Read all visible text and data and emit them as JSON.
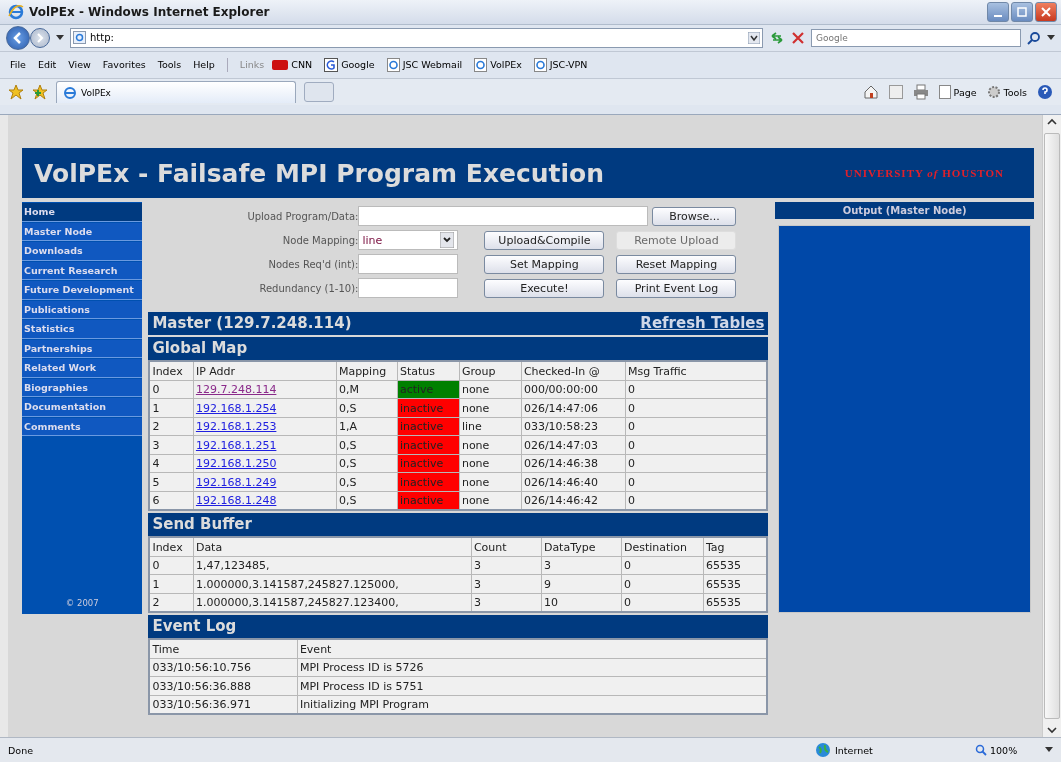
{
  "window": {
    "title": "VolPEx - Windows Internet Explorer"
  },
  "address_bar": {
    "value": "http:"
  },
  "search": {
    "placeholder": "Google"
  },
  "menu": [
    "File",
    "Edit",
    "View",
    "Favorites",
    "Tools",
    "Help"
  ],
  "links": {
    "label": "Links",
    "items": [
      {
        "label": "CNN",
        "kind": "cnn"
      },
      {
        "label": "Google",
        "kind": "google"
      },
      {
        "label": "JSC Webmail",
        "kind": "ie"
      },
      {
        "label": "VolPEx",
        "kind": "ie"
      },
      {
        "label": "JSC-VPN",
        "kind": "ie"
      }
    ]
  },
  "tabs": [
    {
      "label": "VolPEx",
      "selected": true
    }
  ],
  "command_bar": [
    {
      "label": "Page",
      "kind": "page"
    },
    {
      "label": "Tools",
      "kind": "tools"
    }
  ],
  "page": {
    "title": "VolPEx - Failsafe MPI Program Execution",
    "logo": "UNIVERSITY *of* HOUSTON"
  },
  "nav": [
    {
      "label": "Home",
      "selected": true
    },
    {
      "label": "Master Node",
      "selected": false
    },
    {
      "label": "Downloads",
      "selected": false
    },
    {
      "label": "Current Research",
      "selected": false
    },
    {
      "label": "Future Development",
      "selected": false
    },
    {
      "label": "Publications",
      "selected": false
    },
    {
      "label": "Statistics",
      "selected": false
    },
    {
      "label": "Partnerships",
      "selected": false
    },
    {
      "label": "Related Work",
      "selected": false
    },
    {
      "label": "Biographies",
      "selected": false
    },
    {
      "label": "Documentation",
      "selected": false
    },
    {
      "label": "Comments",
      "selected": false
    }
  ],
  "copyright": "© 2007",
  "form": {
    "fields": [
      {
        "label": "Upload Program/Data:",
        "kind": "file"
      },
      {
        "label": "Node Mapping:",
        "kind": "select",
        "value": "line"
      },
      {
        "label": "Nodes Req'd (int):",
        "kind": "text"
      },
      {
        "label": "Redundancy (1-10):",
        "kind": "text"
      }
    ],
    "browse": "Browse...",
    "buttons": [
      {
        "label": "Upload&Compile",
        "disabled": false
      },
      {
        "label": "Remote Upload",
        "disabled": true
      },
      {
        "label": "Set Mapping",
        "disabled": false
      },
      {
        "label": "Reset Mapping",
        "disabled": false
      },
      {
        "label": "Execute!",
        "disabled": false
      },
      {
        "label": "Print Event Log",
        "disabled": false
      }
    ]
  },
  "master": {
    "title": "Master (129.7.248.114)",
    "refresh": "Refresh Tables"
  },
  "global_map": {
    "title": "Global Map",
    "columns": [
      "Index",
      "IP Addr",
      "Mapping",
      "Status",
      "Group",
      "Checked-In @",
      "Msg Traffic"
    ],
    "rows": [
      {
        "index": "0",
        "ip": "129.7.248.114",
        "visited": true,
        "mapping": "0,M",
        "status": "active",
        "color": "#008000",
        "group": "none",
        "checked_in": "000/00:00:00",
        "traffic": "0"
      },
      {
        "index": "1",
        "ip": "192.168.1.254",
        "visited": false,
        "mapping": "0,S",
        "status": "inactive",
        "color": "#ff0000",
        "group": "none",
        "checked_in": "026/14:47:06",
        "traffic": "0"
      },
      {
        "index": "2",
        "ip": "192.168.1.253",
        "visited": false,
        "mapping": "1,A",
        "status": "inactive",
        "color": "#ff0000",
        "group": "line",
        "checked_in": "033/10:58:23",
        "traffic": "0"
      },
      {
        "index": "3",
        "ip": "192.168.1.251",
        "visited": false,
        "mapping": "0,S",
        "status": "inactive",
        "color": "#ff0000",
        "group": "none",
        "checked_in": "026/14:47:03",
        "traffic": "0"
      },
      {
        "index": "4",
        "ip": "192.168.1.250",
        "visited": false,
        "mapping": "0,S",
        "status": "inactive",
        "color": "#ff0000",
        "group": "none",
        "checked_in": "026/14:46:38",
        "traffic": "0"
      },
      {
        "index": "5",
        "ip": "192.168.1.249",
        "visited": false,
        "mapping": "0,S",
        "status": "inactive",
        "color": "#ff0000",
        "group": "none",
        "checked_in": "026/14:46:40",
        "traffic": "0"
      },
      {
        "index": "6",
        "ip": "192.168.1.248",
        "visited": false,
        "mapping": "0,S",
        "status": "inactive",
        "color": "#ff0000",
        "group": "none",
        "checked_in": "026/14:46:42",
        "traffic": "0"
      }
    ]
  },
  "send_buffer": {
    "title": "Send Buffer",
    "columns": [
      "Index",
      "Data",
      "Count",
      "DataType",
      "Destination",
      "Tag"
    ],
    "rows": [
      [
        "0",
        "1,47,123485,",
        "3",
        "3",
        "0",
        "65535"
      ],
      [
        "1",
        "1.000000,3.141587,245827.125000,",
        "3",
        "9",
        "0",
        "65535"
      ],
      [
        "2",
        "1.000000,3.141587,245827.123400,",
        "3",
        "10",
        "0",
        "65535"
      ]
    ]
  },
  "event_log": {
    "title": "Event Log",
    "columns": [
      "Time",
      "Event"
    ],
    "rows": [
      [
        "033/10:56:10.756",
        "MPI Process ID is 5726"
      ],
      [
        "033/10:56:36.888",
        "MPI Process ID is 5751"
      ],
      [
        "033/10:56:36.971",
        "Initializing MPI Program"
      ]
    ]
  },
  "output": {
    "title": "Output (Master Node)"
  },
  "status_bar": {
    "text": "Done",
    "zone": "Internet",
    "zoom": "100%"
  }
}
